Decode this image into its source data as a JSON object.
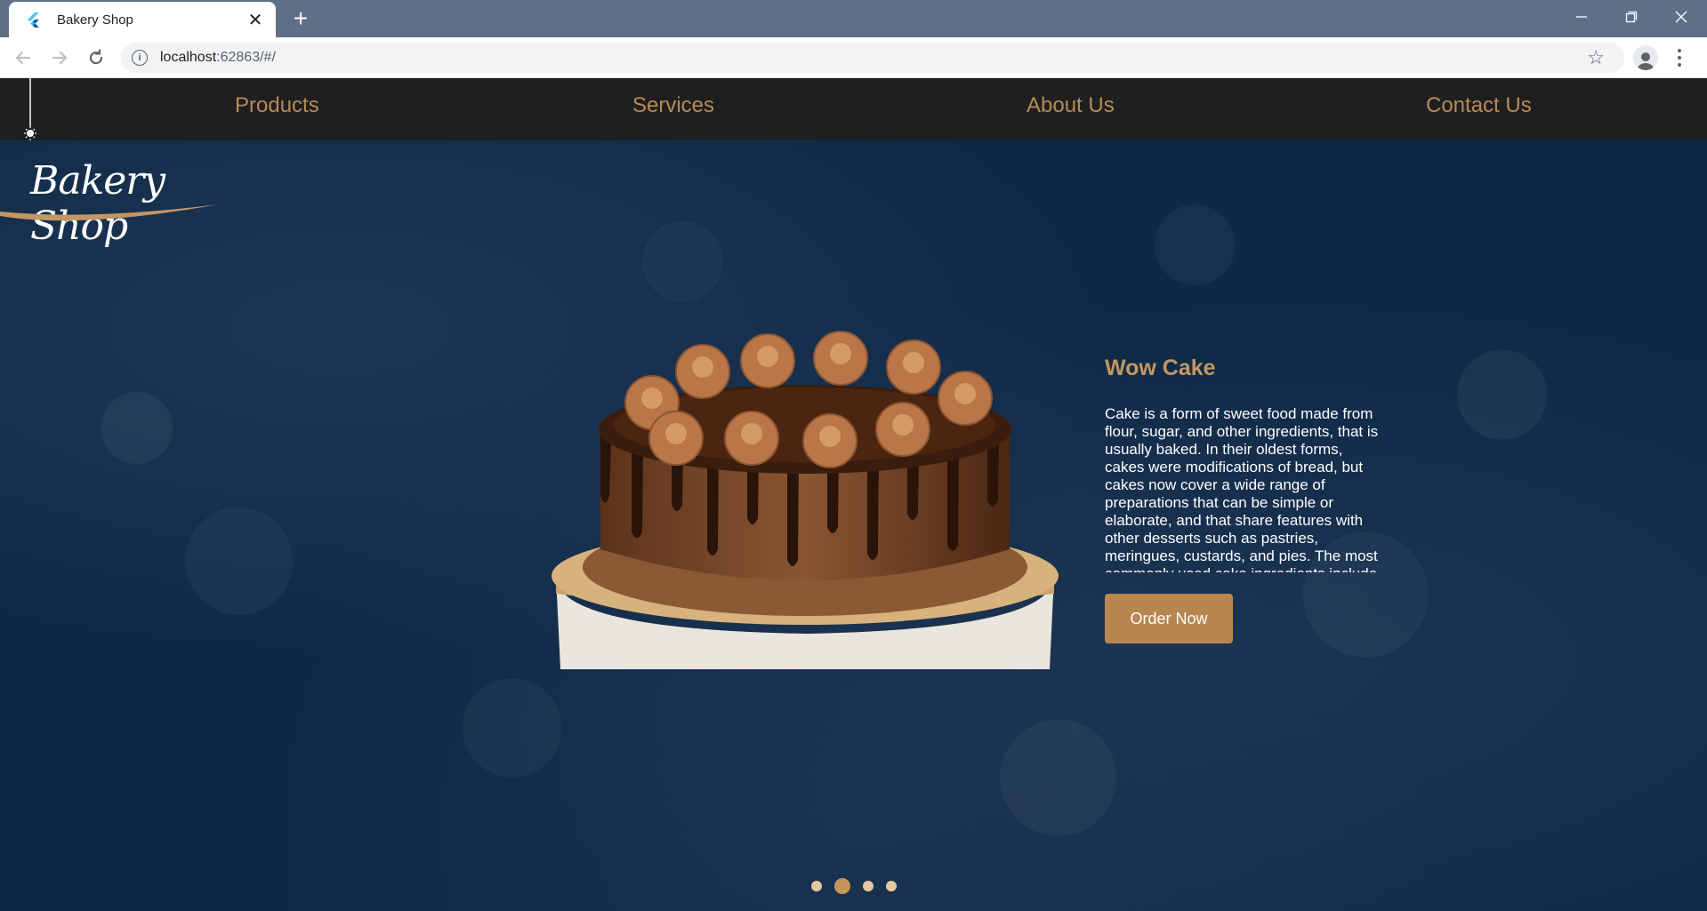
{
  "browser": {
    "tab_title": "Bakery Shop",
    "url_host": "localhost",
    "url_rest": ":62863/#/"
  },
  "nav": {
    "items": [
      "Products",
      "Services",
      "About Us",
      "Contact Us"
    ]
  },
  "logo": {
    "text": "Bakery Shop"
  },
  "product": {
    "title": "Wow Cake",
    "description": "Cake is a form of sweet food made from flour, sugar, and other ingredients, that is usually baked. In their oldest forms, cakes were modifications of bread, but cakes now cover a wide range of preparations that can be simple or elaborate, and that share features with other desserts such as pastries, meringues, custards, and pies. The most commonly used cake ingredients include flour, sugar, eggs, butter or oil or margarine, a liquid, and a leavening agent.",
    "order_label": "Order Now"
  },
  "carousel": {
    "count": 4,
    "active_index": 1
  },
  "colors": {
    "accent": "#b88a57",
    "button": "#b8864f",
    "navbar": "#1f1f1f",
    "background": "#0e2947"
  }
}
